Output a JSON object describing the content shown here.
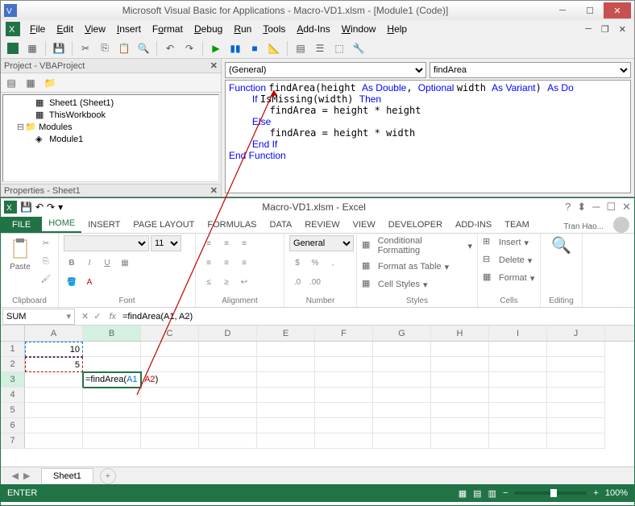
{
  "vba": {
    "title": "Microsoft Visual Basic for Applications - Macro-VD1.xlsm - [Module1 (Code)]",
    "menu": [
      "File",
      "Edit",
      "View",
      "Insert",
      "Format",
      "Debug",
      "Run",
      "Tools",
      "Add-Ins",
      "Window",
      "Help"
    ],
    "project_panel_title": "Project - VBAProject",
    "properties_panel_title": "Properties - Sheet1",
    "tree": {
      "sheet1": "Sheet1 (Sheet1)",
      "thisworkbook": "ThisWorkbook",
      "modules": "Modules",
      "module1": "Module1"
    },
    "dropdown_left": "(General)",
    "dropdown_right": "findArea",
    "code_lines": [
      {
        "t": "Function ",
        "c": "kw-blue",
        "t2": "findArea(height ",
        "c3": "kw-blue",
        "t3": "As Double",
        "t4": ", ",
        "c5": "kw-blue",
        "t5": "Optional ",
        "t6": "width ",
        "c7": "kw-blue",
        "t7": "As Variant",
        "t8": ") ",
        "c9": "kw-blue",
        "t9": "As Do"
      },
      {
        "indent": 1,
        "c": "kw-blue",
        "t": "If ",
        "t2": "IsMissing(width) ",
        "c3": "kw-blue",
        "t3": "Then"
      },
      {
        "indent": 2,
        "t": "findArea = height * height"
      },
      {
        "indent": 1,
        "c": "kw-blue",
        "t": "Else"
      },
      {
        "indent": 2,
        "t": "findArea = height * width"
      },
      {
        "indent": 1,
        "c": "kw-blue",
        "t": "End If"
      },
      {
        "c": "kw-blue",
        "t": "End Function"
      }
    ]
  },
  "excel": {
    "title": "Macro-VD1.xlsm - Excel",
    "user": "Tran Hao...",
    "tabs": [
      "FILE",
      "HOME",
      "INSERT",
      "PAGE LAYOUT",
      "FORMULAS",
      "DATA",
      "REVIEW",
      "VIEW",
      "DEVELOPER",
      "ADD-INS",
      "TEAM"
    ],
    "active_tab": "HOME",
    "ribbon_groups": [
      "Clipboard",
      "Font",
      "Alignment",
      "Number",
      "Styles",
      "Cells",
      "Editing"
    ],
    "font_name": "",
    "font_size": "11",
    "number_format": "General",
    "styles": {
      "cond": "Conditional Formatting",
      "table": "Format as Table",
      "cell": "Cell Styles"
    },
    "cells_grp": {
      "insert": "Insert",
      "delete": "Delete",
      "format": "Format"
    },
    "paste_label": "Paste",
    "editing_label": "Editing",
    "name_box": "SUM",
    "formula_bar": "=findArea(A1, A2)",
    "columns": [
      "A",
      "B",
      "C",
      "D",
      "E",
      "F",
      "G",
      "H",
      "I",
      "J"
    ],
    "rows": [
      "1",
      "2",
      "3",
      "4",
      "5",
      "6",
      "7"
    ],
    "cell_A1": "10",
    "cell_A2": "5",
    "cell_B3_prefix": "=findArea(",
    "cell_B3_ref1": "A1",
    "cell_B3_sep": " , ",
    "cell_B3_ref2": "A2",
    "cell_B3_suffix": ")",
    "sheet_name": "Sheet1",
    "status_mode": "ENTER",
    "zoom": "100%"
  }
}
